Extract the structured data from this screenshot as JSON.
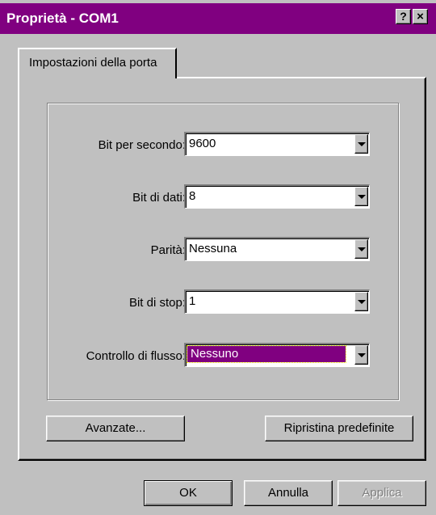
{
  "window": {
    "title": "Proprietà - COM1",
    "help_label": "?",
    "close_label": "×"
  },
  "tabs": [
    {
      "label": "Impostazioni della porta"
    }
  ],
  "settings": [
    {
      "label": "Bit per secondo:",
      "value": "9600"
    },
    {
      "label": "Bit di dati:",
      "value": "8"
    },
    {
      "label": "Parità:",
      "value": "Nessuna"
    },
    {
      "label": "Bit di stop:",
      "value": "1"
    },
    {
      "label": "Controllo di flusso:",
      "value": "Nessuno"
    }
  ],
  "buttons": {
    "advanced": "Avanzate...",
    "restore_defaults": "Ripristina predefinite",
    "ok": "OK",
    "cancel": "Annulla",
    "apply": "Applica"
  },
  "colors": {
    "titlebar": "#800080",
    "selection": "#800080",
    "face": "#c0c0c0"
  }
}
